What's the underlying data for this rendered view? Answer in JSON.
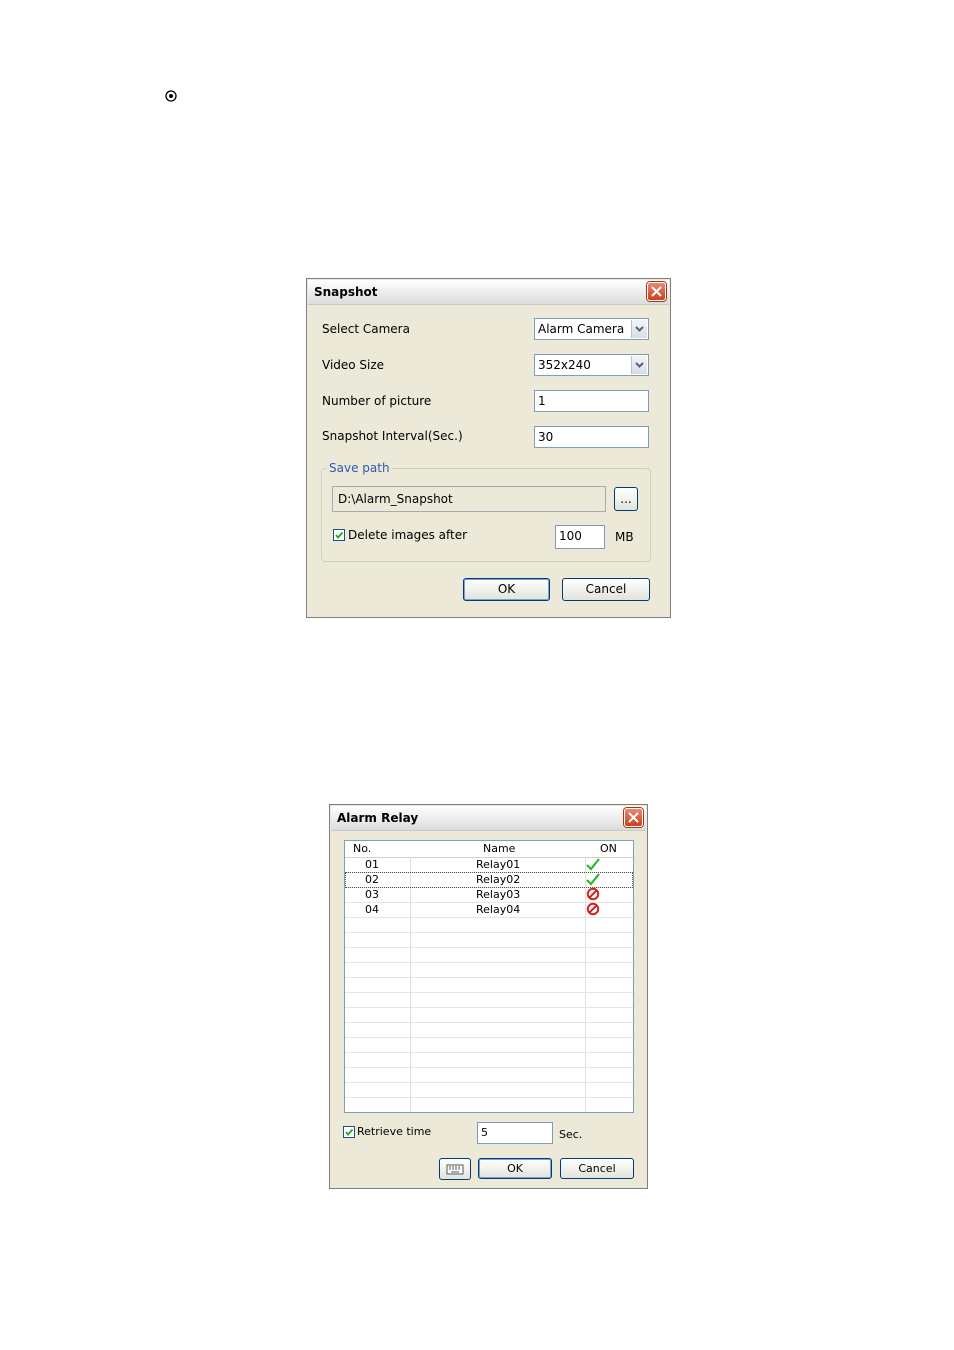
{
  "snapshot_dialog": {
    "title": "Snapshot",
    "select_camera_label": "Select Camera",
    "select_camera_value": "Alarm Camera",
    "video_size_label": "Video Size",
    "video_size_value": "352x240",
    "number_of_picture_label": "Number of picture",
    "number_of_picture_value": "1",
    "snapshot_interval_label": "Snapshot Interval(Sec.)",
    "snapshot_interval_value": "30",
    "save_path_group_label": "Save path",
    "save_path_value": "D:\\Alarm_Snapshot",
    "browse_label": "...",
    "delete_images_label": "Delete images after",
    "delete_images_checked": true,
    "delete_images_value": "100",
    "delete_images_unit": "MB",
    "ok_label": "OK",
    "cancel_label": "Cancel"
  },
  "alarm_relay_dialog": {
    "title": "Alarm Relay",
    "columns": [
      "No.",
      "Name",
      "ON"
    ],
    "rows": [
      {
        "no": "01",
        "name": "Relay01",
        "on": "check-icon"
      },
      {
        "no": "02",
        "name": "Relay02",
        "on": "check-icon"
      },
      {
        "no": "03",
        "name": "Relay03",
        "on": "no-icon"
      },
      {
        "no": "04",
        "name": "Relay04",
        "on": "no-icon"
      }
    ],
    "retrieve_time_label": "Retrieve time",
    "retrieve_time_checked": true,
    "retrieve_time_value": "5",
    "retrieve_time_unit": "Sec.",
    "ok_label": "OK",
    "cancel_label": "Cancel"
  }
}
